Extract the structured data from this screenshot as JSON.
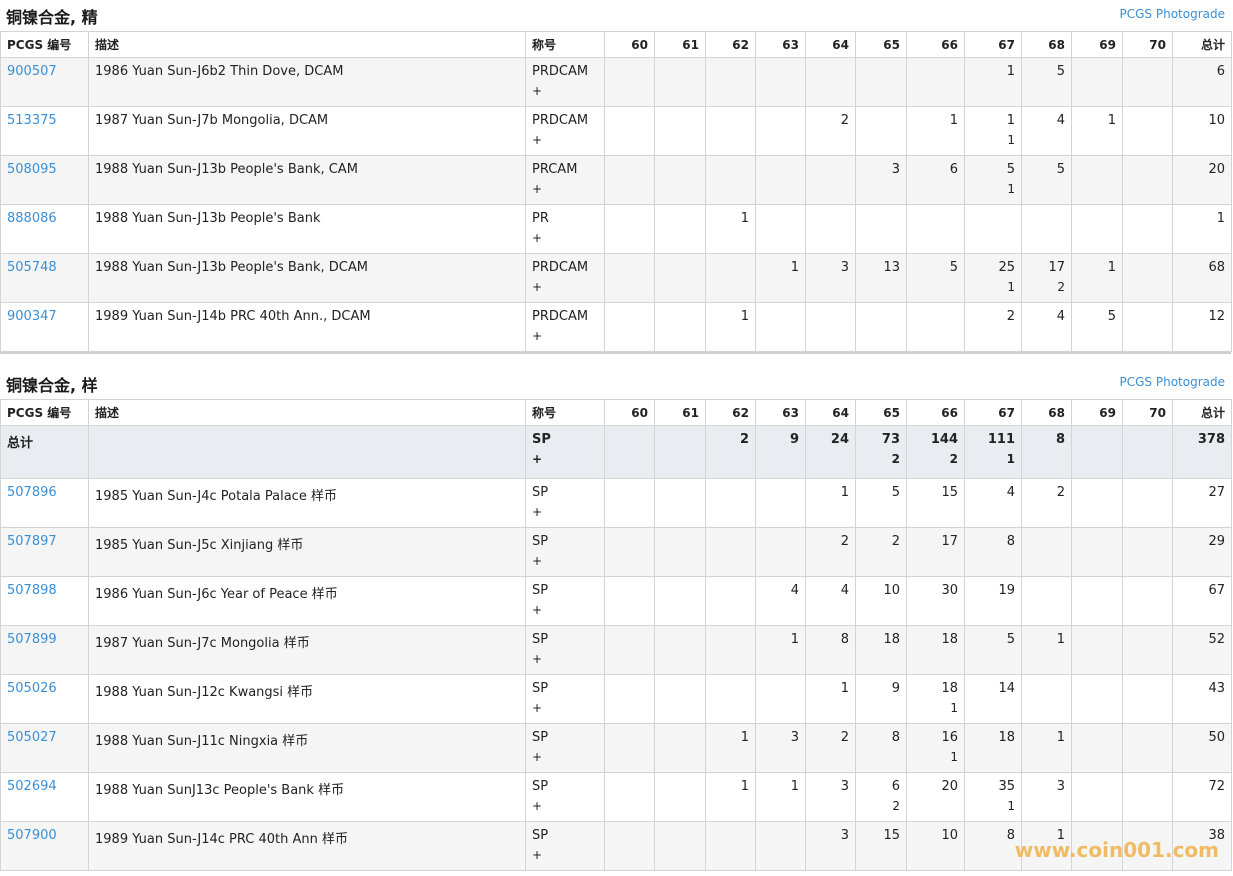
{
  "sections": [
    {
      "title": "铜镍合金, 精",
      "link": "PCGS Photograde",
      "columns": [
        "PCGS 编号",
        "描述",
        "称号",
        "60",
        "61",
        "62",
        "63",
        "64",
        "65",
        "66",
        "67",
        "68",
        "69",
        "70",
        "总计"
      ],
      "rows": [
        {
          "id": "900507",
          "desc": "1986 Yuan Sun-J6b2 Thin Dove, DCAM",
          "des": "PRDCAM",
          "plus": "+",
          "g": [
            "",
            "",
            "",
            "",
            "",
            "",
            "",
            "1",
            "5",
            "",
            "",
            ""
          ],
          "s": [
            "",
            "",
            "",
            "",
            "",
            "",
            "",
            "",
            "",
            "",
            "",
            ""
          ],
          "total": "6"
        },
        {
          "id": "513375",
          "desc": "1987 Yuan Sun-J7b Mongolia, DCAM",
          "des": "PRDCAM",
          "plus": "+",
          "g": [
            "",
            "",
            "",
            "",
            "2",
            "",
            "1",
            "1",
            "4",
            "1",
            "",
            ""
          ],
          "s": [
            "",
            "",
            "",
            "",
            "",
            "",
            "",
            "1",
            "",
            "",
            "",
            ""
          ],
          "total": "10"
        },
        {
          "id": "508095",
          "desc": "1988 Yuan Sun-J13b People's Bank, CAM",
          "des": "PRCAM",
          "plus": "+",
          "g": [
            "",
            "",
            "",
            "",
            "",
            "3",
            "6",
            "5",
            "5",
            "",
            "",
            ""
          ],
          "s": [
            "",
            "",
            "",
            "",
            "",
            "",
            "",
            "1",
            "",
            "",
            "",
            ""
          ],
          "total": "20"
        },
        {
          "id": "888086",
          "desc": "1988 Yuan Sun-J13b People's Bank",
          "des": "PR",
          "plus": "+",
          "g": [
            "",
            "",
            "1",
            "",
            "",
            "",
            "",
            "",
            "",
            "",
            "",
            ""
          ],
          "s": [
            "",
            "",
            "",
            "",
            "",
            "",
            "",
            "",
            "",
            "",
            "",
            ""
          ],
          "total": "1"
        },
        {
          "id": "505748",
          "desc": "1988 Yuan Sun-J13b People's Bank, DCAM",
          "des": "PRDCAM",
          "plus": "+",
          "g": [
            "",
            "",
            "",
            "1",
            "3",
            "13",
            "5",
            "25",
            "17",
            "1",
            "",
            ""
          ],
          "s": [
            "",
            "",
            "",
            "",
            "",
            "",
            "",
            "1",
            "2",
            "",
            "",
            ""
          ],
          "total": "68"
        },
        {
          "id": "900347",
          "desc": "1989 Yuan Sun-J14b PRC 40th Ann., DCAM",
          "des": "PRDCAM",
          "plus": "+",
          "g": [
            "",
            "",
            "1",
            "",
            "",
            "",
            "",
            "2",
            "4",
            "5",
            "",
            ""
          ],
          "s": [
            "",
            "",
            "",
            "",
            "",
            "",
            "",
            "",
            "",
            "",
            "",
            ""
          ],
          "total": "12"
        }
      ]
    },
    {
      "title": "铜镍合金, 样",
      "link": "PCGS Photograde",
      "columns": [
        "PCGS 编号",
        "描述",
        "称号",
        "60",
        "61",
        "62",
        "63",
        "64",
        "65",
        "66",
        "67",
        "68",
        "69",
        "70",
        "总计"
      ],
      "total_row": {
        "label": "总计",
        "des": "SP",
        "plus": "+",
        "g": [
          "",
          "",
          "2",
          "9",
          "24",
          "73",
          "144",
          "111",
          "8",
          "",
          ""
        ],
        "s": [
          "",
          "",
          "",
          "",
          "",
          "2",
          "2",
          "1",
          "",
          "",
          ""
        ],
        "total": "378"
      },
      "rows": [
        {
          "id": "507896",
          "desc": "1985 Yuan Sun-J4c Potala Palace 样币",
          "des": "SP",
          "plus": "+",
          "g": [
            "",
            "",
            "",
            "",
            "1",
            "5",
            "15",
            "4",
            "2",
            "",
            ""
          ],
          "s": [
            "",
            "",
            "",
            "",
            "",
            "",
            "",
            "",
            "",
            "",
            ""
          ],
          "total": "27"
        },
        {
          "id": "507897",
          "desc": "1985 Yuan Sun-J5c Xinjiang 样币",
          "des": "SP",
          "plus": "+",
          "g": [
            "",
            "",
            "",
            "",
            "2",
            "2",
            "17",
            "8",
            "",
            "",
            ""
          ],
          "s": [
            "",
            "",
            "",
            "",
            "",
            "",
            "",
            "",
            "",
            "",
            ""
          ],
          "total": "29"
        },
        {
          "id": "507898",
          "desc": "1986 Yuan Sun-J6c Year of Peace 样币",
          "des": "SP",
          "plus": "+",
          "g": [
            "",
            "",
            "",
            "4",
            "4",
            "10",
            "30",
            "19",
            "",
            "",
            ""
          ],
          "s": [
            "",
            "",
            "",
            "",
            "",
            "",
            "",
            "",
            "",
            "",
            ""
          ],
          "total": "67"
        },
        {
          "id": "507899",
          "desc": "1987 Yuan Sun-J7c Mongolia 样币",
          "des": "SP",
          "plus": "+",
          "g": [
            "",
            "",
            "",
            "1",
            "8",
            "18",
            "18",
            "5",
            "1",
            "",
            ""
          ],
          "s": [
            "",
            "",
            "",
            "",
            "",
            "",
            "",
            "",
            "",
            "",
            ""
          ],
          "total": "52"
        },
        {
          "id": "505026",
          "desc": "1988 Yuan Sun-J12c Kwangsi 样币",
          "des": "SP",
          "plus": "+",
          "g": [
            "",
            "",
            "",
            "",
            "1",
            "9",
            "18",
            "14",
            "",
            "",
            ""
          ],
          "s": [
            "",
            "",
            "",
            "",
            "",
            "",
            "1",
            "",
            "",
            "",
            ""
          ],
          "total": "43"
        },
        {
          "id": "505027",
          "desc": "1988 Yuan Sun-J11c Ningxia 样币",
          "des": "SP",
          "plus": "+",
          "g": [
            "",
            "",
            "1",
            "3",
            "2",
            "8",
            "16",
            "18",
            "1",
            "",
            ""
          ],
          "s": [
            "",
            "",
            "",
            "",
            "",
            "",
            "1",
            "",
            "",
            "",
            ""
          ],
          "total": "50"
        },
        {
          "id": "502694",
          "desc": "1988 Yuan SunJ13c People's Bank 样币",
          "des": "SP",
          "plus": "+",
          "g": [
            "",
            "",
            "1",
            "1",
            "3",
            "6",
            "20",
            "35",
            "3",
            "",
            ""
          ],
          "s": [
            "",
            "",
            "",
            "",
            "",
            "2",
            "",
            "1",
            "",
            "",
            ""
          ],
          "total": "72"
        },
        {
          "id": "507900",
          "desc": "1989 Yuan Sun-J14c PRC 40th Ann 样币",
          "des": "SP",
          "plus": "+",
          "g": [
            "",
            "",
            "",
            "",
            "3",
            "15",
            "10",
            "8",
            "1",
            "",
            ""
          ],
          "s": [
            "",
            "",
            "",
            "",
            "",
            "",
            "",
            "",
            "",
            "",
            ""
          ],
          "total": "38"
        }
      ]
    }
  ],
  "watermark": "www.coin001.com"
}
